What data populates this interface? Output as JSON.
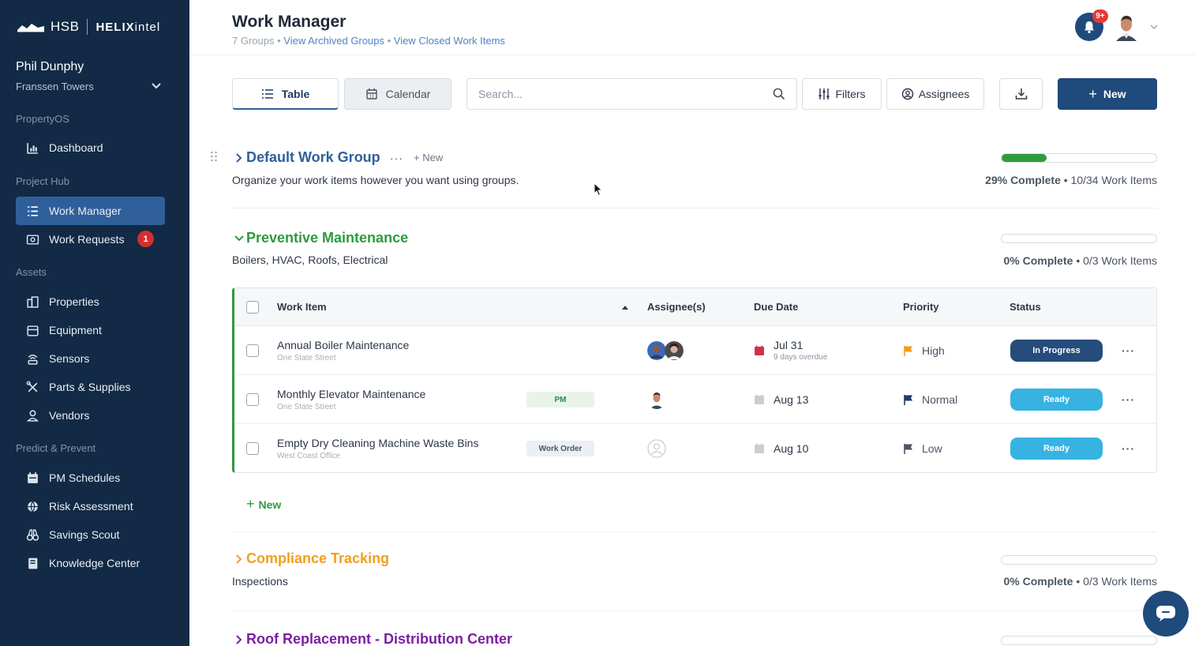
{
  "brand": {
    "hsb": "HSB",
    "helix_bold": "HELIX",
    "helix_light": "intel"
  },
  "user": {
    "name": "Phil Dunphy",
    "site": "Franssen Towers"
  },
  "sidebar": {
    "sections": [
      {
        "label": "PropertyOS"
      },
      {
        "label": "Project Hub"
      },
      {
        "label": "Assets"
      },
      {
        "label": "Predict & Prevent"
      }
    ],
    "items": [
      {
        "label": "Dashboard",
        "icon": "chart-icon"
      },
      {
        "label": "Work Manager",
        "icon": "list-icon",
        "active": true
      },
      {
        "label": "Work Requests",
        "icon": "inbox-icon",
        "badge": "1"
      },
      {
        "label": "Properties",
        "icon": "building-icon"
      },
      {
        "label": "Equipment",
        "icon": "equipment-icon"
      },
      {
        "label": "Sensors",
        "icon": "sensor-icon"
      },
      {
        "label": "Parts & Supplies",
        "icon": "tools-icon"
      },
      {
        "label": "Vendors",
        "icon": "vendor-icon"
      },
      {
        "label": "PM Schedules",
        "icon": "calendar-icon"
      },
      {
        "label": "Risk Assessment",
        "icon": "globe-icon"
      },
      {
        "label": "Savings Scout",
        "icon": "binoculars-icon"
      },
      {
        "label": "Knowledge Center",
        "icon": "book-icon"
      }
    ]
  },
  "header": {
    "title": "Work Manager",
    "groups_count": "7 Groups",
    "sep": "•",
    "archived_link": "View Archived Groups",
    "closed_link": "View Closed Work Items",
    "notif_badge": "9+"
  },
  "toolbar": {
    "table_label": "Table",
    "calendar_label": "Calendar",
    "search_placeholder": "Search...",
    "filters_label": "Filters",
    "assignees_label": "Assignees",
    "new_label": "New",
    "new_plus": "+"
  },
  "colors": {
    "sidebar_bg": "#122a45",
    "accent": "#1f4a7c",
    "green": "#2e9a3e",
    "orange": "#f0a020",
    "purple": "#7b1fa2",
    "ready": "#36b3e3"
  },
  "groups": [
    {
      "title": "Default Work Group",
      "more": "···",
      "new_label": "+ New",
      "description": "Organize your work items however you want using groups.",
      "progress": 0.29,
      "percent_label": "29% Complete",
      "sep": "•",
      "count_label": "10/34 Work Items",
      "color": "#2f5f9a"
    },
    {
      "title": "Preventive Maintenance",
      "description": "Boilers, HVAC, Roofs, Electrical",
      "progress": 0,
      "percent_label": "0% Complete",
      "sep": "•",
      "count_label": "0/3 Work Items",
      "color": "#2e9a3e"
    },
    {
      "title": "Compliance Tracking",
      "description": "Inspections",
      "progress": 0,
      "percent_label": "0% Complete",
      "sep": "•",
      "count_label": "0/3 Work Items",
      "color": "#f0a020"
    },
    {
      "title": "Roof Replacement - Distribution Center",
      "color": "#7b1fa2"
    }
  ],
  "table": {
    "headers": {
      "work_item": "Work Item",
      "assignees": "Assignee(s)",
      "due_date": "Due Date",
      "priority": "Priority",
      "status": "Status"
    },
    "rows": [
      {
        "name": "Annual Boiler Maintenance",
        "location": "One State Street",
        "tag": "",
        "due": "Jul 31",
        "due_note": "9 days overdue",
        "priority": "High",
        "status": "In Progress",
        "more": "···"
      },
      {
        "name": "Monthly Elevator Maintenance",
        "location": "One State Street",
        "tag": "PM",
        "due": "Aug 13",
        "due_note": "",
        "priority": "Normal",
        "status": "Ready",
        "more": "···"
      },
      {
        "name": "Empty Dry Cleaning Machine Waste Bins",
        "location": "West Coast Office",
        "tag": "Work Order",
        "due": "Aug 10",
        "due_note": "",
        "priority": "Low",
        "status": "Ready",
        "more": "···"
      }
    ],
    "add_new_label": "New",
    "add_new_plus": "+"
  }
}
